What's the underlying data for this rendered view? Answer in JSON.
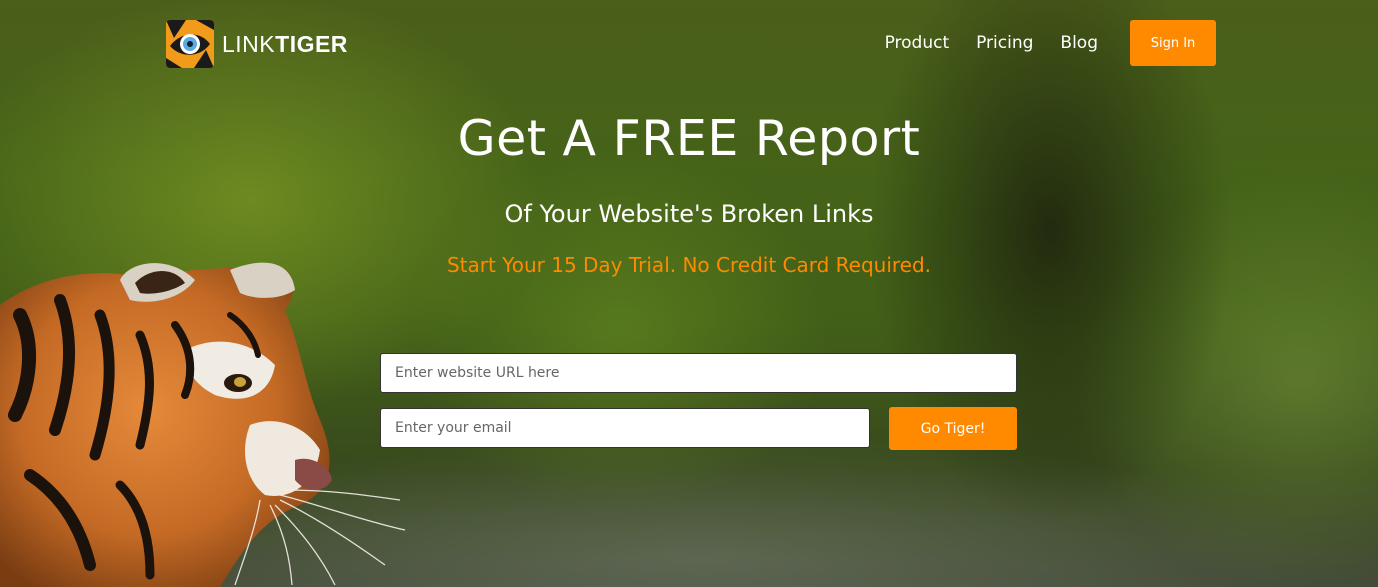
{
  "header": {
    "logo": {
      "text_light": "LINK",
      "text_bold": "TIGER",
      "icon": "tiger-eye-icon"
    },
    "nav": [
      {
        "label": "Product"
      },
      {
        "label": "Pricing"
      },
      {
        "label": "Blog"
      }
    ],
    "signin_label": "Sign In"
  },
  "hero": {
    "headline": "Get A FREE Report",
    "subhead": "Of Your Website's Broken Links",
    "trial_text": "Start Your 15 Day Trial. No Credit Card Required."
  },
  "form": {
    "url_placeholder": "Enter website URL here",
    "email_placeholder": "Enter your email",
    "submit_label": "Go Tiger!"
  },
  "colors": {
    "accent": "#ff8a00",
    "text": "#ffffff"
  }
}
